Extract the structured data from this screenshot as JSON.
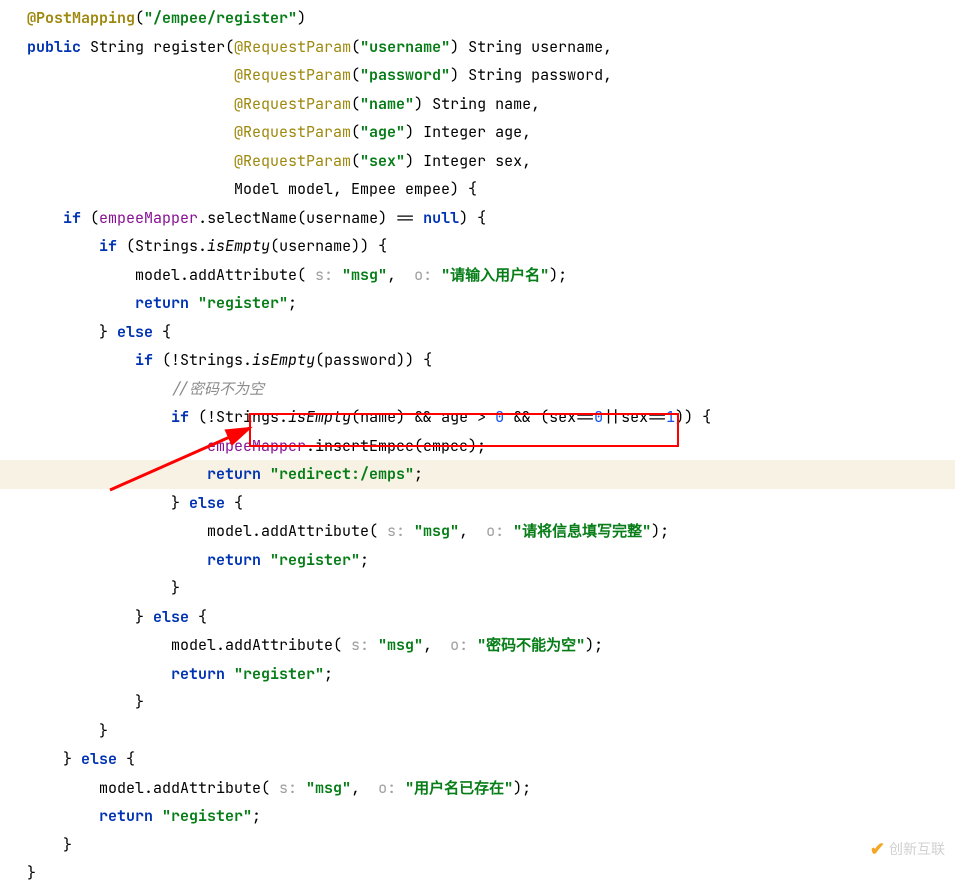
{
  "code": {
    "l1_anno": "@PostMapping",
    "l1_paren_open": "(",
    "l1_url": "\"/empee/register\"",
    "l1_paren_close": ")",
    "l2_kw1": "public",
    "l2_type": "String",
    "l2_name": "register(",
    "l2_anno": "@RequestParam",
    "l2_p1": "(",
    "l2_str": "\"username\"",
    "l2_rest": ") String username,",
    "l3_anno": "@RequestParam",
    "l3_p1": "(",
    "l3_str": "\"password\"",
    "l3_rest": ") String password,",
    "l4_anno": "@RequestParam",
    "l4_p1": "(",
    "l4_str": "\"name\"",
    "l4_rest": ") String name,",
    "l5_anno": "@RequestParam",
    "l5_p1": "(",
    "l5_str": "\"age\"",
    "l5_rest": ") Integer age,",
    "l6_anno": "@RequestParam",
    "l6_p1": "(",
    "l6_str": "\"sex\"",
    "l6_rest": ") Integer sex,",
    "l7": "Model model, Empee empee) {",
    "l8_kw": "if",
    "l8_a": " (",
    "l8_field": "empeeMapper",
    "l8_b": ".selectName(username) == ",
    "l8_null": "null",
    "l8_c": ") {",
    "l9_kw": "if",
    "l9_a": " (Strings.",
    "l9_it": "isEmpty",
    "l9_b": "(username)) {",
    "l10_a": "model.addAttribute( ",
    "l10_h1": "s: ",
    "l10_s1": "\"msg\"",
    "l10_b": ",  ",
    "l10_h2": "o: ",
    "l10_s2": "\"请输入用户名\"",
    "l10_c": ");",
    "l11_kw": "return",
    "l11_s": " \"register\"",
    "l11_c": ";",
    "l12": "} ",
    "l12_kw": "else",
    "l12_b": " {",
    "l13_kw": "if",
    "l13_a": " (!Strings.",
    "l13_it": "isEmpty",
    "l13_b": "(password)) {",
    "l14_cmt": "//密码不为空",
    "l15_kw": "if",
    "l15_a": " (!Strings.",
    "l15_it": "isEmpty",
    "l15_b": "(name) && age > ",
    "l15_n0": "0",
    "l15_c": " && (sex==",
    "l15_n1": "0",
    "l15_d": "||sex==",
    "l15_n2": "1",
    "l15_e": ")) {",
    "l16_field": "empeeMapper",
    "l16_b": ".insertEmpee(empee);",
    "l17_kw": "return",
    "l17_s": " \"redirect:/emps\"",
    "l17_c": ";",
    "l18": "} ",
    "l18_kw": "else",
    "l18_b": " {",
    "l19_a": "model.addAttribute( ",
    "l19_h1": "s: ",
    "l19_s1": "\"msg\"",
    "l19_b": ",  ",
    "l19_h2": "o: ",
    "l19_s2": "\"请将信息填写完整\"",
    "l19_c": ");",
    "l20_kw": "return",
    "l20_s": " \"register\"",
    "l20_c": ";",
    "l21": "}",
    "l22": "} ",
    "l22_kw": "else",
    "l22_b": " {",
    "l23_a": "model.addAttribute( ",
    "l23_h1": "s: ",
    "l23_s1": "\"msg\"",
    "l23_b": ",  ",
    "l23_h2": "o: ",
    "l23_s2": "\"密码不能为空\"",
    "l23_c": ");",
    "l24_kw": "return",
    "l24_s": " \"register\"",
    "l24_c": ";",
    "l25": "}",
    "l26": "}",
    "l27": "} ",
    "l27_kw": "else",
    "l27_b": " {",
    "l28_a": "model.addAttribute( ",
    "l28_h1": "s: ",
    "l28_s1": "\"msg\"",
    "l28_b": ",  ",
    "l28_h2": "o: ",
    "l28_s2": "\"用户名已存在\"",
    "l28_c": ");",
    "l29_kw": "return",
    "l29_s": " \"register\"",
    "l29_c": ";",
    "l30": "}",
    "l31": "}"
  },
  "watermark": "创新互联"
}
